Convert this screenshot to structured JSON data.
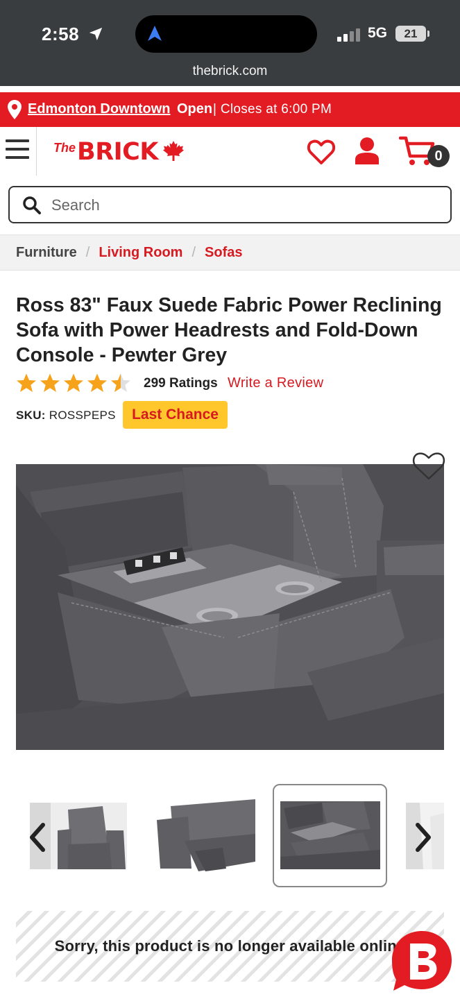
{
  "status_bar": {
    "time": "2:58",
    "network": "5G",
    "battery": "21",
    "url": "thebrick.com"
  },
  "store_bar": {
    "store_name": "Edmonton Downtown",
    "open_status": "Open",
    "hours": "| Closes at 6:00 PM"
  },
  "header": {
    "logo_prefix": "The",
    "logo_name": "BRICK",
    "cart_count": "0"
  },
  "search": {
    "placeholder": "Search"
  },
  "breadcrumb": {
    "items": [
      "Furniture",
      "Living Room",
      "Sofas"
    ]
  },
  "product": {
    "title": "Ross 83\" Faux Suede Fabric Power Reclining Sofa with Power Headrests and Fold-Down Console - Pewter Grey",
    "rating": 4.5,
    "ratings_count": "299 Ratings",
    "write_review": "Write a Review",
    "sku_label": "SKU:",
    "sku_value": "ROSSPEPS",
    "badge": "Last Chance",
    "unavailable_message": "Sorry, this product is no longer available online"
  },
  "colors": {
    "brand_red": "#e31c23",
    "badge_yellow": "#ffc72c",
    "star_orange": "#f7a21b",
    "status_bar": "#3a3d40"
  },
  "icons": [
    "location-pin-icon",
    "hamburger-menu-icon",
    "maple-leaf-icon",
    "heart-icon",
    "user-icon",
    "cart-icon",
    "search-icon",
    "star-icon",
    "chevron-left-icon",
    "chevron-right-icon",
    "chat-icon"
  ]
}
